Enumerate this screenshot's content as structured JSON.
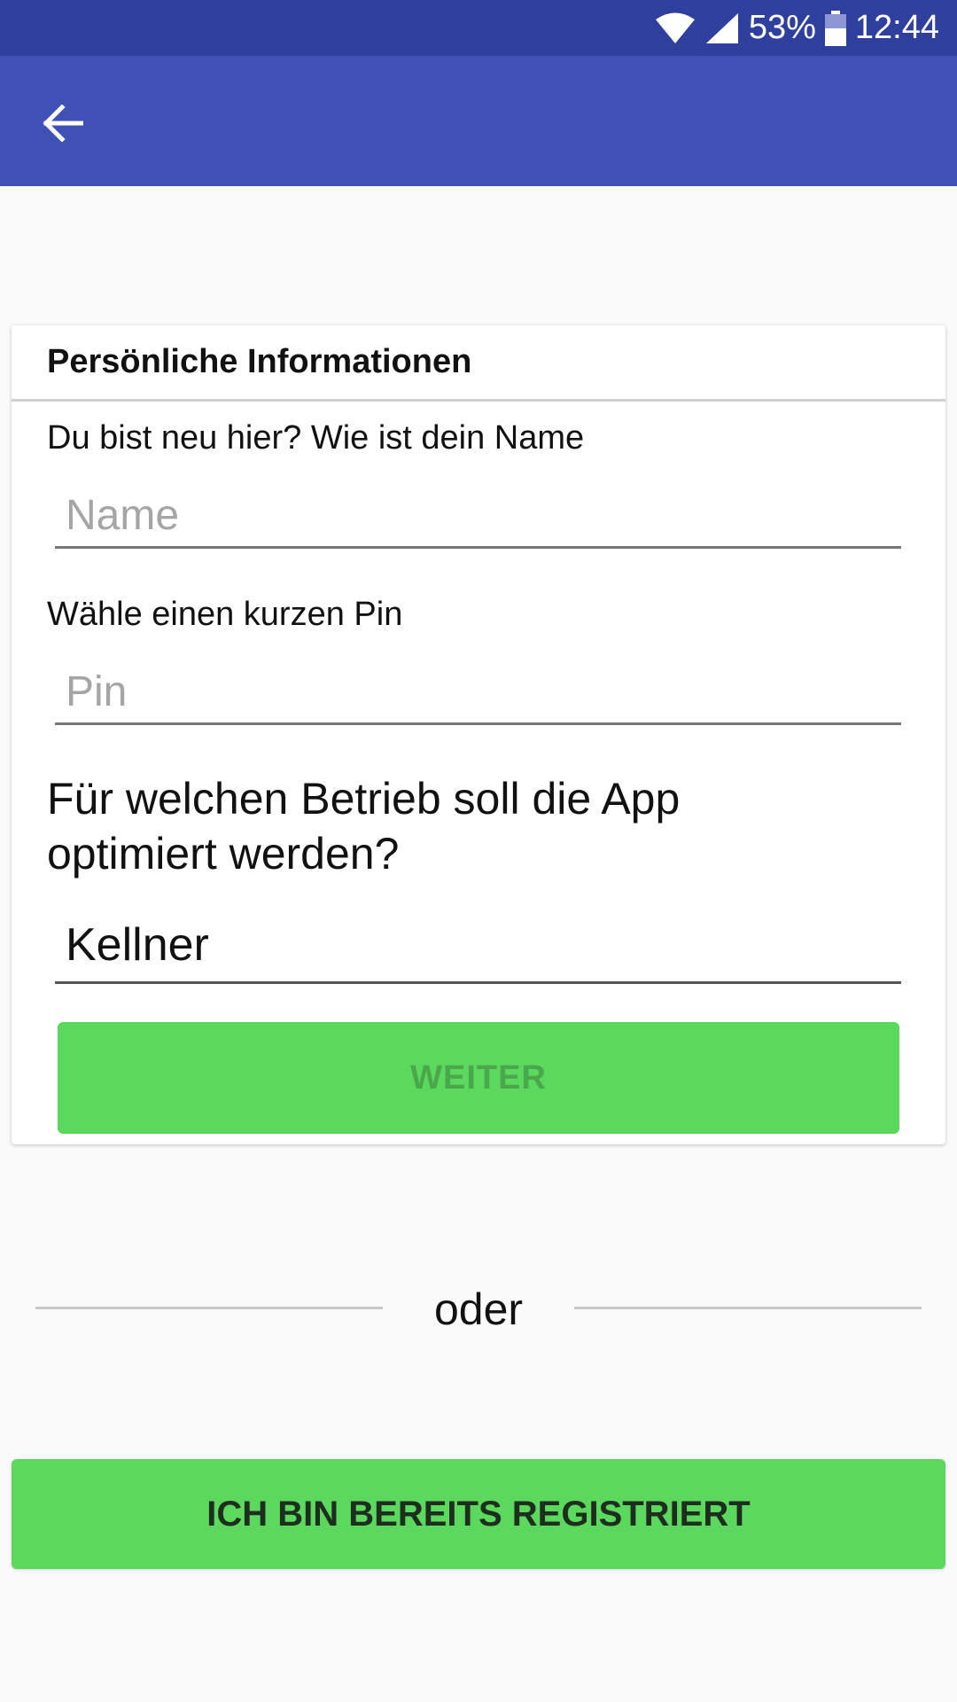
{
  "status_bar": {
    "battery_percent": "53%",
    "time": "12:44",
    "icons": [
      "wifi-icon",
      "cell-signal-icon",
      "battery-icon"
    ]
  },
  "app_bar": {
    "back_icon": "arrow-left-icon",
    "color": "#3f51b5",
    "status_color": "#2f3f9e"
  },
  "card": {
    "title": "Persönliche Informationen",
    "name_label": "Du bist neu hier? Wie ist dein Name",
    "name_placeholder": "Name",
    "name_value": "",
    "pin_label": "Wähle einen kurzen Pin",
    "pin_placeholder": "Pin",
    "pin_value": "",
    "business_question_line1": "Für welchen Betrieb soll die App",
    "business_question_line2": "optimiert werden?",
    "business_selected": "Kellner",
    "continue_button": "WEITER"
  },
  "divider": {
    "text": "oder"
  },
  "already_registered_button": "ICH BIN BEREITS REGISTRIERT",
  "colors": {
    "accent_green": "#5cd85e",
    "disabled_text_green": "#4aa74c",
    "background": "#fafafa"
  }
}
